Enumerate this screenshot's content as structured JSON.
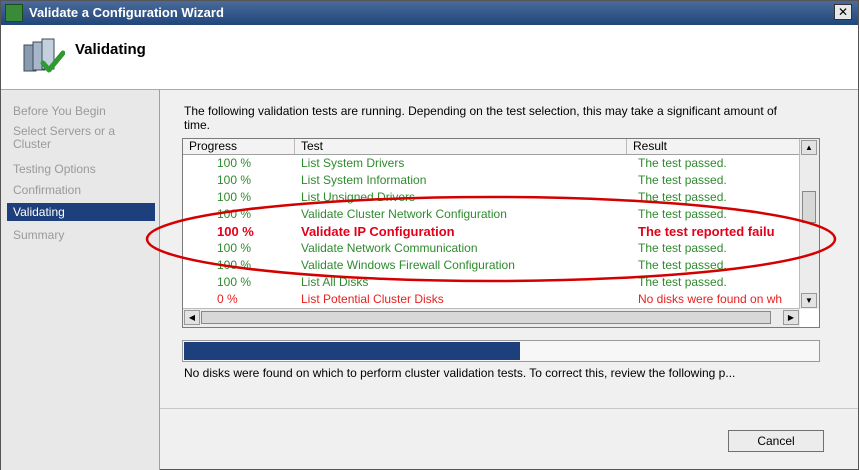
{
  "window": {
    "title": "Validate a Configuration Wizard",
    "close_label": "✕"
  },
  "header": {
    "title": "Validating"
  },
  "nav": {
    "items": [
      {
        "label": "Before You Begin"
      },
      {
        "label": "Select Servers or a Cluster"
      },
      {
        "label": "Testing Options"
      },
      {
        "label": "Confirmation"
      },
      {
        "label": "Validating"
      },
      {
        "label": "Summary"
      }
    ],
    "active_index": 4
  },
  "main": {
    "description": "The following validation tests are running. Depending on the test selection, this may take a significant amount of time.",
    "columns": [
      "Progress",
      "Test",
      "Result"
    ],
    "rows": [
      {
        "progress": "100 %",
        "test": "List System Drivers",
        "result": "The test passed.",
        "state": "pass"
      },
      {
        "progress": "100 %",
        "test": "List System Information",
        "result": "The test passed.",
        "state": "pass"
      },
      {
        "progress": "100 %",
        "test": "List Unsigned Drivers",
        "result": "The test passed.",
        "state": "pass"
      },
      {
        "progress": "100 %",
        "test": "Validate Cluster Network Configuration",
        "result": "The test passed.",
        "state": "pass"
      },
      {
        "progress": "100 %",
        "test": "Validate IP Configuration",
        "result": "The test reported failu",
        "state": "fail"
      },
      {
        "progress": "100 %",
        "test": "Validate Network Communication",
        "result": "The test passed.",
        "state": "pass"
      },
      {
        "progress": "100 %",
        "test": "Validate Windows Firewall Configuration",
        "result": "The test passed.",
        "state": "pass"
      },
      {
        "progress": "100 %",
        "test": "List All Disks",
        "result": "The test passed.",
        "state": "pass"
      },
      {
        "progress": "0 %",
        "test": "List Potential Cluster Disks",
        "result": "No disks were found on wh",
        "state": "warn"
      }
    ],
    "progress_fraction": 0.53,
    "status": "No disks were found on which to perform cluster validation tests. To correct this, review the following p...",
    "cancel_label": "Cancel"
  },
  "colors": {
    "pass": "#2e8b2e",
    "fail": "#e3001b",
    "highlight_ellipse": "#d40000",
    "active_nav": "#1d3f7c"
  },
  "icons": {
    "app": "cluster-validate-icon",
    "header": "cluster-servers-check-icon"
  }
}
